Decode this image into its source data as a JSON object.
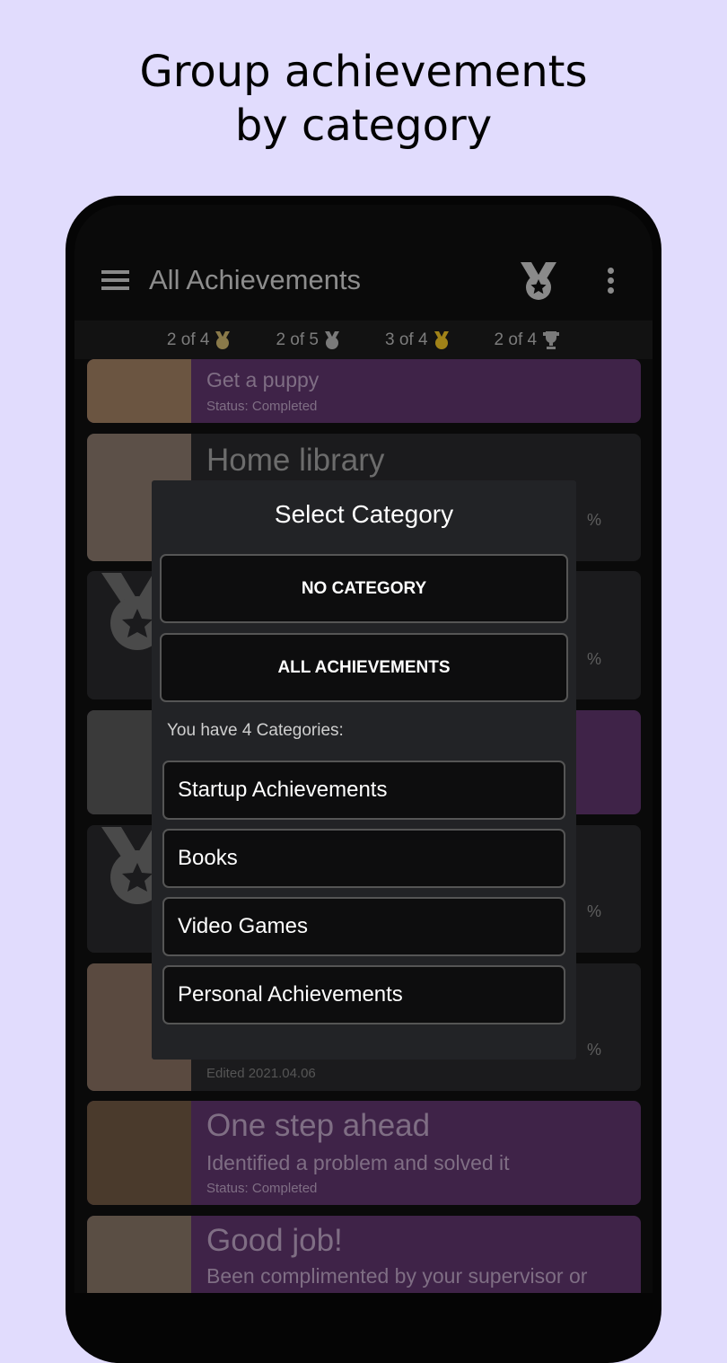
{
  "headline": {
    "line1": "Group achievements",
    "line2": "by category"
  },
  "appbar": {
    "title": "All Achievements",
    "menu_icon": "hamburger-icon",
    "action_icon": "medal-icon",
    "overflow_icon": "more-vert-icon"
  },
  "stats": [
    {
      "text": "2 of 4",
      "icon": "bronze-medal-icon",
      "color": "#8a7a4a"
    },
    {
      "text": "2 of 5",
      "icon": "silver-medal-icon",
      "color": "#7a7a7a"
    },
    {
      "text": "3 of 4",
      "icon": "gold-medal-icon",
      "color": "#a08218"
    },
    {
      "text": "2 of 4",
      "icon": "trophy-icon",
      "color": "#7a7a7a"
    }
  ],
  "cards": [
    {
      "title": "Get a puppy",
      "status": "Status: Completed"
    },
    {
      "title": "Home library",
      "percent": "%"
    },
    {
      "percent": "%"
    },
    {},
    {
      "percent": "%"
    },
    {
      "percent": "%",
      "edited": "Edited  2021.04.06"
    },
    {
      "title": "One step ahead",
      "description": "Identified a problem and solved it",
      "status": "Status: Completed"
    },
    {
      "title": "Good job!",
      "description": "Been complimented by your supervisor or"
    }
  ],
  "dialog": {
    "title": "Select Category",
    "no_category": "NO CATEGORY",
    "all_achievements": "ALL ACHIEVEMENTS",
    "count_label": "You have 4 Categories:",
    "categories": [
      "Startup Achievements",
      "Books",
      "Video Games",
      "Personal Achievements"
    ]
  },
  "colors": {
    "background": "#e1dcfd",
    "completed_card": "#3f2348",
    "dialog": "#222326"
  }
}
